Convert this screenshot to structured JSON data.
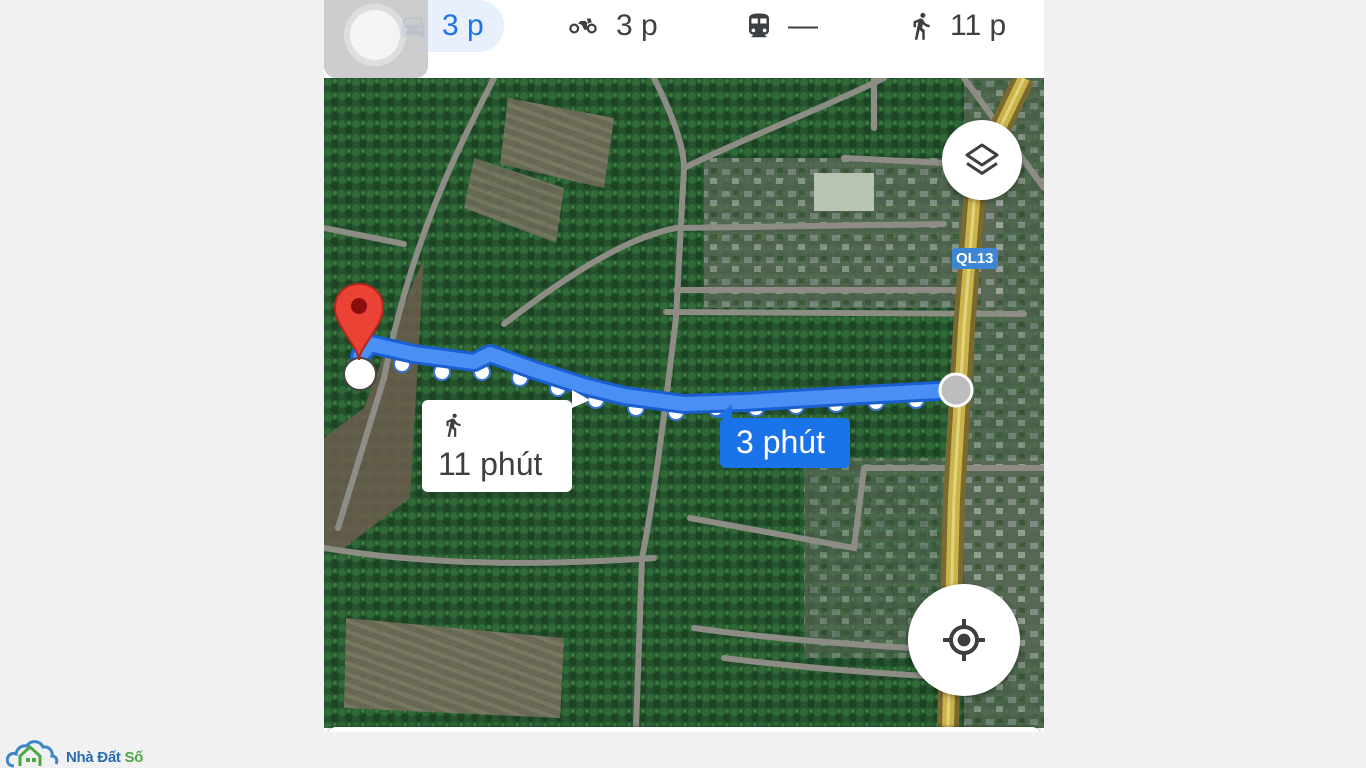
{
  "modes": {
    "car": {
      "icon": "car-icon",
      "time": "3 p"
    },
    "motorbike": {
      "icon": "motorbike-icon",
      "time": "3 p"
    },
    "transit": {
      "icon": "train-icon",
      "time": "—"
    },
    "walk": {
      "icon": "walk-icon",
      "time": "11 p"
    }
  },
  "map": {
    "road_label": "QL13",
    "walk_callout": {
      "icon": "walk-icon",
      "text": "11 phút"
    },
    "drive_callout": {
      "text": "3 phút"
    },
    "layers_button": {
      "icon": "layers-icon"
    },
    "locate_button": {
      "icon": "my-location-icon"
    },
    "destination_marker": {
      "icon": "map-pin-icon"
    }
  },
  "colors": {
    "route": "#4285f4",
    "active_mode": "#1a73e8",
    "pin": "#ea4335"
  },
  "watermark": {
    "brand_part1": "Nhà Đất",
    "brand_part2": "Số"
  }
}
